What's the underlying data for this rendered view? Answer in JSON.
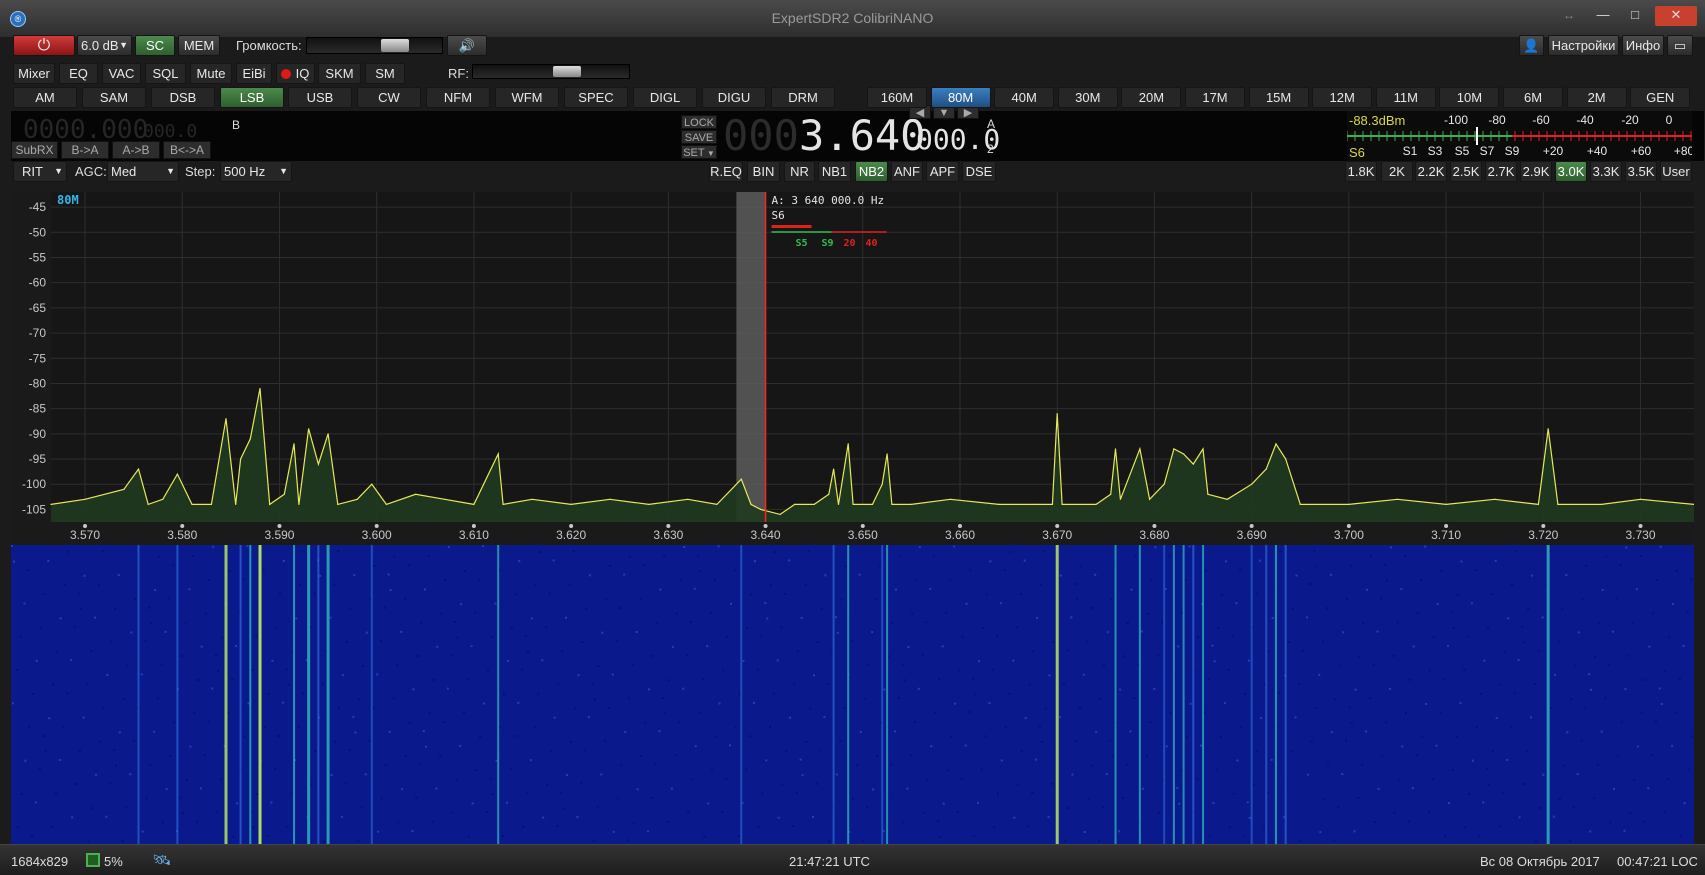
{
  "window": {
    "title": "ExpertSDR2 ColibriNANO",
    "minimize": "—",
    "maximize": "□",
    "close": "✕",
    "resize": "↔"
  },
  "toolbar1": {
    "attenuation": "6.0 dB",
    "sc": "SC",
    "mem": "MEM",
    "volume_label": "Громкость:",
    "volume_level": 0.65,
    "settings": "Настройки",
    "info": "Инфо"
  },
  "toolbar2": {
    "buttons": [
      "Mixer",
      "EQ",
      "VAC",
      "SQL",
      "Mute",
      "EiBi",
      "IQ",
      "SKM",
      "SM"
    ],
    "rf_label": "RF:",
    "rf_level": 0.6
  },
  "modes": {
    "items": [
      "AM",
      "SAM",
      "DSB",
      "LSB",
      "USB",
      "CW",
      "NFM",
      "WFM",
      "SPEC",
      "DIGL",
      "DIGU",
      "DRM"
    ],
    "active": "LSB"
  },
  "bands": {
    "items": [
      "160M",
      "80M",
      "40M",
      "30M",
      "20M",
      "17M",
      "15M",
      "12M",
      "11M",
      "10M",
      "6M",
      "2M",
      "GEN"
    ],
    "active": "80M"
  },
  "vfo": {
    "sub_freq": "0000.000",
    "sub_freq_small": "000.0",
    "sub_label": "B",
    "subrx": "SubRX",
    "b_to_a": "B->A",
    "a_to_b": "A->B",
    "swap": "B<->A",
    "lock": "LOCK",
    "save": "SAVE",
    "set": "SET",
    "main_freq_dim": "000",
    "main_freq": "3.640",
    "main_freq_small": "000.0",
    "vfo_label": "A",
    "vfo_num": "2"
  },
  "smeter": {
    "dbm": "-88.3dBm",
    "s_value": "S6",
    "top_scale": [
      "-100",
      "-80",
      "-60",
      "-40",
      "-20",
      "0"
    ],
    "bottom_scale": [
      "S1",
      "S3",
      "S5",
      "S7",
      "S9",
      "+20",
      "+40",
      "+60",
      "+80"
    ]
  },
  "controls": {
    "rit": "RIT",
    "agc_label": "AGC:",
    "agc_value": "Med",
    "step_label": "Step:",
    "step_value": "500 Hz",
    "dsp": [
      "R.EQ",
      "BIN",
      "NR",
      "NB1",
      "NB2",
      "ANF",
      "APF",
      "DSE"
    ],
    "dsp_active": "NB2",
    "filters": [
      "1.8K",
      "2K",
      "2.2K",
      "2.5K",
      "2.7K",
      "2.9K",
      "3.0K",
      "3.3K",
      "3.5K",
      "User"
    ],
    "filter_active": "3.0K"
  },
  "panorama": {
    "band_label": "80M",
    "marker_freq": "A: 3 640 000.0 Hz",
    "marker_s": "S6",
    "mini_scale": [
      "S5",
      "S9",
      "20",
      "40"
    ]
  },
  "chart_data": {
    "type": "line",
    "title": "",
    "xlabel": "",
    "ylabel": "",
    "xlim": [
      3.5665,
      3.7355
    ],
    "ylim": [
      -107.5,
      -42
    ],
    "x_ticks": [
      "3.570",
      "3.580",
      "3.590",
      "3.600",
      "3.610",
      "3.620",
      "3.630",
      "3.640",
      "3.650",
      "3.660",
      "3.670",
      "3.680",
      "3.690",
      "3.700",
      "3.710",
      "3.720",
      "3.730"
    ],
    "y_ticks": [
      "-45",
      "-50",
      "-55",
      "-60",
      "-65",
      "-70",
      "-75",
      "-80",
      "-85",
      "-90",
      "-95",
      "-100",
      "-105"
    ],
    "noise_floor": -105,
    "series": [
      {
        "values": [
          [
            3.5665,
            -104
          ],
          [
            3.57,
            -103
          ],
          [
            3.574,
            -101
          ],
          [
            3.5755,
            -97
          ],
          [
            3.5765,
            -104
          ],
          [
            3.578,
            -103
          ],
          [
            3.5795,
            -98
          ],
          [
            3.581,
            -104
          ],
          [
            3.583,
            -104
          ],
          [
            3.5845,
            -87
          ],
          [
            3.5855,
            -104
          ],
          [
            3.586,
            -95
          ],
          [
            3.587,
            -91
          ],
          [
            3.588,
            -81
          ],
          [
            3.589,
            -104
          ],
          [
            3.5905,
            -102
          ],
          [
            3.5915,
            -92
          ],
          [
            3.592,
            -104
          ],
          [
            3.593,
            -89
          ],
          [
            3.594,
            -96
          ],
          [
            3.595,
            -90
          ],
          [
            3.596,
            -104
          ],
          [
            3.598,
            -103
          ],
          [
            3.5995,
            -100
          ],
          [
            3.601,
            -104
          ],
          [
            3.604,
            -102
          ],
          [
            3.607,
            -103
          ],
          [
            3.61,
            -104
          ],
          [
            3.6125,
            -94
          ],
          [
            3.613,
            -104
          ],
          [
            3.616,
            -103
          ],
          [
            3.62,
            -104
          ],
          [
            3.624,
            -103
          ],
          [
            3.628,
            -104
          ],
          [
            3.632,
            -103
          ],
          [
            3.635,
            -104
          ],
          [
            3.6375,
            -99
          ],
          [
            3.6385,
            -104
          ],
          [
            3.6395,
            -105
          ],
          [
            3.6415,
            -106
          ],
          [
            3.643,
            -104
          ],
          [
            3.645,
            -104
          ],
          [
            3.6465,
            -102
          ],
          [
            3.647,
            -97
          ],
          [
            3.6475,
            -104
          ],
          [
            3.6485,
            -92
          ],
          [
            3.649,
            -104
          ],
          [
            3.651,
            -104
          ],
          [
            3.652,
            -100
          ],
          [
            3.6525,
            -94
          ],
          [
            3.653,
            -104
          ],
          [
            3.655,
            -104
          ],
          [
            3.659,
            -103
          ],
          [
            3.664,
            -104
          ],
          [
            3.668,
            -104
          ],
          [
            3.6695,
            -104
          ],
          [
            3.67,
            -86
          ],
          [
            3.6705,
            -104
          ],
          [
            3.674,
            -104
          ],
          [
            3.6755,
            -102
          ],
          [
            3.676,
            -93
          ],
          [
            3.6765,
            -103
          ],
          [
            3.6785,
            -93
          ],
          [
            3.6795,
            -103
          ],
          [
            3.681,
            -100
          ],
          [
            3.682,
            -93
          ],
          [
            3.683,
            -94
          ],
          [
            3.684,
            -96
          ],
          [
            3.685,
            -93
          ],
          [
            3.6855,
            -102
          ],
          [
            3.6875,
            -103
          ],
          [
            3.69,
            -100
          ],
          [
            3.6915,
            -97
          ],
          [
            3.6925,
            -92
          ],
          [
            3.6935,
            -95
          ],
          [
            3.695,
            -104
          ],
          [
            3.7,
            -104
          ],
          [
            3.705,
            -103
          ],
          [
            3.71,
            -104
          ],
          [
            3.715,
            -103
          ],
          [
            3.7195,
            -104
          ],
          [
            3.7205,
            -89
          ],
          [
            3.7215,
            -104
          ],
          [
            3.726,
            -104
          ],
          [
            3.73,
            -103
          ],
          [
            3.7355,
            -104
          ]
        ]
      }
    ]
  },
  "status": {
    "resolution": "1684x829",
    "cpu": "5%",
    "utc": "21:47:21 UTC",
    "date": "Вс 08 Октябрь 2017",
    "loc": "00:47:21 LOC"
  },
  "colors": {
    "spectrum_line": "#e8e85a",
    "spectrum_fill": "#1f3a1f",
    "active_green": "#3d7a3d",
    "active_blue": "#2f78c8",
    "marker_red": "#ff2020",
    "band_label": "#2fb6e8"
  },
  "icons": {
    "power": "power-icon",
    "speaker": "speaker-icon",
    "user": "user-icon",
    "window": "window-icon",
    "cpu": "cpu-icon",
    "satellite": "satellite-icon"
  }
}
